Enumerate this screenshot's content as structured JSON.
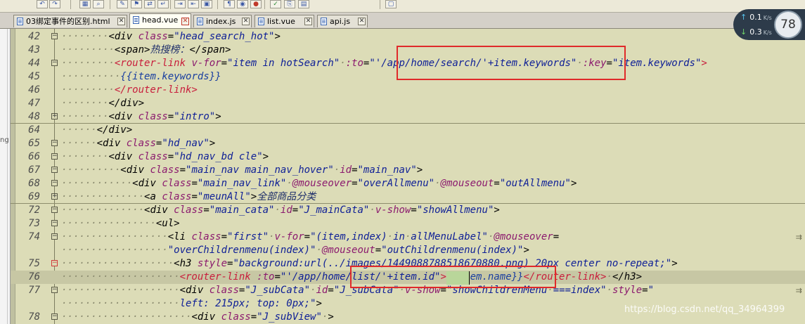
{
  "toolbar": {
    "buttons": [
      "undo-icon",
      "redo-icon",
      "split-icon",
      "find-icon",
      "tag-icon",
      "bookmark-icon",
      "replace-icon",
      "wrap-icon",
      "indent-icon",
      "outdent-icon",
      "view-icon",
      "paragraph-icon",
      "browser-icon",
      "stop-icon",
      "check-icon",
      "copy-icon",
      "paste-icon",
      "window-icon"
    ]
  },
  "tabs": [
    {
      "label": "03绑定事件的区别.html",
      "active": false
    },
    {
      "label": "head.vue",
      "active": true
    },
    {
      "label": "index.js",
      "active": false
    },
    {
      "label": "list.vue",
      "active": false
    },
    {
      "label": "api.js",
      "active": false
    }
  ],
  "left_panel": {
    "fragment": "ng"
  },
  "speed": {
    "up": "0.1",
    "up_unit": "K/s",
    "down": "0.3",
    "down_unit": "K/s",
    "percent": "78"
  },
  "colors": {
    "editor_bg": "#dcdcb7",
    "highlight_bg": "#c7c7a4",
    "annotation_box": "#e02a2a"
  },
  "watermark": "https://blog.csdn.net/qq_34964399",
  "lines": [
    {
      "num": "42",
      "fold": "box",
      "segs": [
        [
          "dots",
          "········"
        ],
        [
          "tg",
          "<div "
        ],
        [
          "at",
          "class"
        ],
        [
          "tg",
          "="
        ],
        [
          "sv",
          "\"head_search_hot\""
        ],
        [
          "tg",
          ">"
        ]
      ]
    },
    {
      "num": "43",
      "fold": "line",
      "segs": [
        [
          "dots",
          "·········"
        ],
        [
          "tg",
          "<span>"
        ],
        [
          "tx",
          "热搜榜："
        ],
        [
          "tg",
          "</span>"
        ]
      ]
    },
    {
      "num": "44",
      "fold": "box",
      "segs": [
        [
          "dots",
          "·········"
        ],
        [
          "tgp",
          "<router-link "
        ],
        [
          "at",
          "v-for"
        ],
        [
          "tg",
          "="
        ],
        [
          "sv",
          "\"item in hotSearch\""
        ],
        [
          "dots",
          "·"
        ],
        [
          "at",
          ":to"
        ],
        [
          "tg",
          "="
        ],
        [
          "sv",
          "\"'/app/home/search/'+item.keywords\""
        ],
        [
          "dots",
          "·"
        ],
        [
          "at",
          ":key"
        ],
        [
          "tg",
          "="
        ],
        [
          "sv",
          "\"item.keywords\""
        ],
        [
          "tgp",
          ">"
        ]
      ]
    },
    {
      "num": "45",
      "fold": "line",
      "segs": [
        [
          "dots",
          "··········"
        ],
        [
          "mu",
          "{{item.keywords}}"
        ]
      ]
    },
    {
      "num": "46",
      "fold": "line",
      "segs": [
        [
          "dots",
          "·········"
        ],
        [
          "tgp",
          "</router-link>"
        ]
      ]
    },
    {
      "num": "47",
      "fold": "line",
      "segs": [
        [
          "dots",
          "········"
        ],
        [
          "tg",
          "</div>"
        ]
      ]
    },
    {
      "num": "48",
      "fold": "plus",
      "segs": [
        [
          "dots",
          "········"
        ],
        [
          "tg",
          "<div "
        ],
        [
          "at",
          "class"
        ],
        [
          "tg",
          "="
        ],
        [
          "sv",
          "\"intro\""
        ],
        [
          "tg",
          ">"
        ]
      ]
    },
    {
      "num": "64",
      "fold": "line",
      "segs": [
        [
          "dots",
          "······"
        ],
        [
          "tg",
          "</div>"
        ]
      ]
    },
    {
      "num": "65",
      "fold": "box",
      "segs": [
        [
          "dots",
          "······"
        ],
        [
          "tg",
          "<div "
        ],
        [
          "at",
          "class"
        ],
        [
          "tg",
          "="
        ],
        [
          "sv",
          "\"hd_nav\""
        ],
        [
          "tg",
          ">"
        ]
      ]
    },
    {
      "num": "66",
      "fold": "box",
      "segs": [
        [
          "dots",
          "········"
        ],
        [
          "tg",
          "<div "
        ],
        [
          "at",
          "class"
        ],
        [
          "tg",
          "="
        ],
        [
          "sv",
          "\"hd_nav_bd cle\""
        ],
        [
          "tg",
          ">"
        ]
      ]
    },
    {
      "num": "67",
      "fold": "box",
      "segs": [
        [
          "dots",
          "··········"
        ],
        [
          "tg",
          "<div "
        ],
        [
          "at",
          "class"
        ],
        [
          "tg",
          "="
        ],
        [
          "sv",
          "\"main_nav main_nav_hover\""
        ],
        [
          "dots",
          "·"
        ],
        [
          "at",
          "id"
        ],
        [
          "tg",
          "="
        ],
        [
          "sv",
          "\"main_nav\""
        ],
        [
          "tg",
          ">"
        ]
      ]
    },
    {
      "num": "68",
      "fold": "box",
      "segs": [
        [
          "dots",
          "············"
        ],
        [
          "tg",
          "<div "
        ],
        [
          "at",
          "class"
        ],
        [
          "tg",
          "="
        ],
        [
          "sv",
          "\"main_nav_link\""
        ],
        [
          "dots",
          "·"
        ],
        [
          "at",
          "@mouseover"
        ],
        [
          "tg",
          "="
        ],
        [
          "sv",
          "\"overAllmenu\""
        ],
        [
          "dots",
          "·"
        ],
        [
          "at",
          "@mouseout"
        ],
        [
          "tg",
          "="
        ],
        [
          "sv",
          "\"outAllmenu\""
        ],
        [
          "tg",
          ">"
        ]
      ]
    },
    {
      "num": "69",
      "fold": "plus",
      "segs": [
        [
          "dots",
          "··············"
        ],
        [
          "tg",
          "<a "
        ],
        [
          "at",
          "class"
        ],
        [
          "tg",
          "="
        ],
        [
          "sv",
          "\"meunAll\""
        ],
        [
          "tg",
          ">"
        ],
        [
          "tx",
          "全部商品分类"
        ]
      ]
    },
    {
      "num": "72",
      "fold": "box",
      "segs": [
        [
          "dots",
          "··············"
        ],
        [
          "tg",
          "<div "
        ],
        [
          "at",
          "class"
        ],
        [
          "tg",
          "="
        ],
        [
          "sv",
          "\"main_cata\""
        ],
        [
          "dots",
          "·"
        ],
        [
          "at",
          "id"
        ],
        [
          "tg",
          "="
        ],
        [
          "sv",
          "\"J_mainCata\""
        ],
        [
          "dots",
          "·"
        ],
        [
          "at",
          "v-show"
        ],
        [
          "tg",
          "="
        ],
        [
          "sv",
          "\"showAllmenu\""
        ],
        [
          "tg",
          ">"
        ]
      ]
    },
    {
      "num": "73",
      "fold": "box",
      "segs": [
        [
          "dots",
          "················"
        ],
        [
          "tg",
          "<ul>"
        ]
      ]
    },
    {
      "num": "74",
      "fold": "box",
      "wrap": true,
      "segs": [
        [
          "dots",
          "··················"
        ],
        [
          "tg",
          "<li "
        ],
        [
          "at",
          "class"
        ],
        [
          "tg",
          "="
        ],
        [
          "sv",
          "\"first\""
        ],
        [
          "dots",
          "·"
        ],
        [
          "at",
          "v-for"
        ],
        [
          "tg",
          "="
        ],
        [
          "sv",
          "\"(item,index)"
        ],
        [
          "dots",
          "·"
        ],
        [
          "sv",
          "in"
        ],
        [
          "dots",
          "·"
        ],
        [
          "sv",
          "allMenuLabel\""
        ],
        [
          "dots",
          "·"
        ],
        [
          "at",
          "@mouseover"
        ],
        [
          "tg",
          "="
        ]
      ]
    },
    {
      "num": "",
      "fold": "line",
      "segs": [
        [
          "dots",
          "··················"
        ],
        [
          "sv",
          "\"overChildrenmenu(index)\""
        ],
        [
          "dots",
          "·"
        ],
        [
          "at",
          "@mouseout"
        ],
        [
          "tg",
          "="
        ],
        [
          "sv",
          "\"outChildrenmenu(index)\""
        ],
        [
          "tg",
          ">"
        ]
      ]
    },
    {
      "num": "75",
      "fold": "boxred",
      "segs": [
        [
          "dots",
          "···················"
        ],
        [
          "tg",
          "<h3 "
        ],
        [
          "at",
          "style"
        ],
        [
          "tg",
          "="
        ],
        [
          "sv",
          "\"background:url(../images/1449088788518670880.png) 20px center no-repeat;\""
        ],
        [
          "tg",
          ">"
        ]
      ]
    },
    {
      "num": "76",
      "fold": "line",
      "highlight": true,
      "segs": [
        [
          "dots",
          "····················"
        ],
        [
          "tgp",
          "<router-link "
        ],
        [
          "at",
          ":to"
        ],
        [
          "tg",
          "="
        ],
        [
          "sv",
          "\"'/app/home/list/'+item.id\""
        ],
        [
          "tgp",
          ">"
        ],
        [
          "mu",
          "{{item.name}}"
        ],
        [
          "tgp",
          "</router-link>"
        ],
        [
          "dots",
          "·"
        ],
        [
          "tg",
          "</h3>"
        ]
      ]
    },
    {
      "num": "77",
      "fold": "box",
      "wrap": true,
      "segs": [
        [
          "dots",
          "····················"
        ],
        [
          "tg",
          "<div "
        ],
        [
          "at",
          "class"
        ],
        [
          "tg",
          "="
        ],
        [
          "sv",
          "\"J_subCata\""
        ],
        [
          "dots",
          "·"
        ],
        [
          "at",
          "id"
        ],
        [
          "tg",
          "="
        ],
        [
          "sv",
          "\"J_subCata\""
        ],
        [
          "dots",
          "·"
        ],
        [
          "at",
          "v-show"
        ],
        [
          "tg",
          "="
        ],
        [
          "sv",
          "\"showChildrenMenu"
        ],
        [
          "dots",
          "·"
        ],
        [
          "sv",
          "===index\""
        ],
        [
          "dots",
          "·"
        ],
        [
          "at",
          "style"
        ],
        [
          "tg",
          "="
        ],
        [
          "sv",
          "\""
        ]
      ]
    },
    {
      "num": "",
      "fold": "line",
      "segs": [
        [
          "dots",
          "····················"
        ],
        [
          "sv",
          "left: 215px; top: 0px;\""
        ],
        [
          "tg",
          ">"
        ]
      ]
    },
    {
      "num": "78",
      "fold": "box",
      "segs": [
        [
          "dots",
          "······················"
        ],
        [
          "tg",
          "<div "
        ],
        [
          "at",
          "class"
        ],
        [
          "tg",
          "="
        ],
        [
          "sv",
          "\"J_subView\""
        ],
        [
          "dots",
          "·"
        ],
        [
          "tg",
          ">"
        ]
      ]
    }
  ]
}
